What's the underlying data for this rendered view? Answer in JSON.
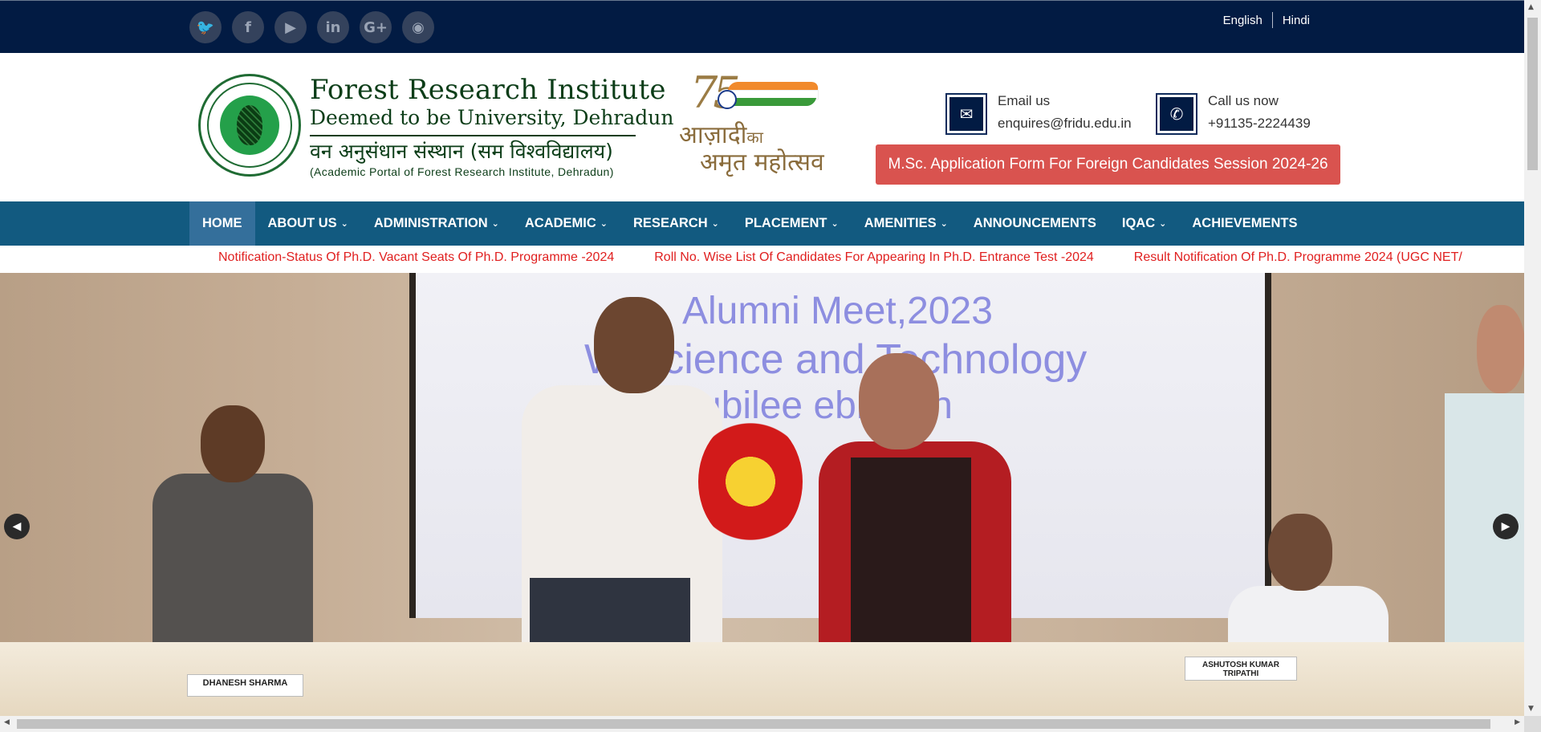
{
  "topbar": {
    "social": [
      {
        "name": "twitter-icon",
        "glyph": "🐦"
      },
      {
        "name": "facebook-icon",
        "glyph": "f"
      },
      {
        "name": "youtube-icon",
        "glyph": "▶"
      },
      {
        "name": "linkedin-icon",
        "glyph": "in"
      },
      {
        "name": "google-plus-icon",
        "glyph": "G+"
      },
      {
        "name": "rss-icon",
        "glyph": "◉"
      }
    ],
    "languages": [
      "English",
      "Hindi"
    ]
  },
  "header": {
    "title_line1": "Forest Research Institute",
    "title_line2": "Deemed to be University, Dehradun",
    "title_hindi": "वन अनुसंधान संस्थान (सम विश्वविद्यालय)",
    "title_sub": "(Academic Portal of Forest Research Institute, Dehradun)",
    "azadi_number": "75",
    "azadi_line1": "आज़ादी",
    "azadi_line1_small": "का",
    "azadi_line2": "अमृत महोत्सव",
    "email_label": "Email us",
    "email_value": "enquires@fridu.edu.in",
    "phone_label": "Call us now",
    "phone_value": "+91135-2224439",
    "apply_button": "M.Sc. Application Form For Foreign Candidates Session 2024-26"
  },
  "nav": {
    "items": [
      {
        "label": "HOME",
        "caret": false
      },
      {
        "label": "ABOUT US",
        "caret": true
      },
      {
        "label": "ADMINISTRATION",
        "caret": true
      },
      {
        "label": "ACADEMIC",
        "caret": true
      },
      {
        "label": "RESEARCH",
        "caret": true
      },
      {
        "label": "PLACEMENT",
        "caret": true
      },
      {
        "label": "AMENITIES",
        "caret": true
      },
      {
        "label": "ANNOUNCEMENTS",
        "caret": false
      },
      {
        "label": "IQAC",
        "caret": true
      },
      {
        "label": "ACHIEVEMENTS",
        "caret": false
      }
    ]
  },
  "ticker": {
    "items": [
      "Notification-Status Of Ph.D. Vacant Seats Of Ph.D. Programme -2024",
      "Roll No. Wise List Of Candidates For Appearing In Ph.D. Entrance Test -2024",
      "Result Notification Of Ph.D. Programme 2024 (UGC NET/"
    ]
  },
  "slider": {
    "screen_line1": "Alumni Meet,2023",
    "screen_line2": "W   Science and Technology",
    "screen_line3": "ver Jubilee    ebration",
    "nameplate1": "DHANESH SHARMA",
    "nameplate2": "ASHUTOSH KUMAR TRIPATHI",
    "prev_glyph": "◀",
    "next_glyph": "▶"
  },
  "colors": {
    "topbar": "#021b43",
    "nav": "#125a80",
    "nav_active": "#346f9b",
    "apply_button": "#d9534f",
    "ticker_text": "#e01f1f"
  }
}
